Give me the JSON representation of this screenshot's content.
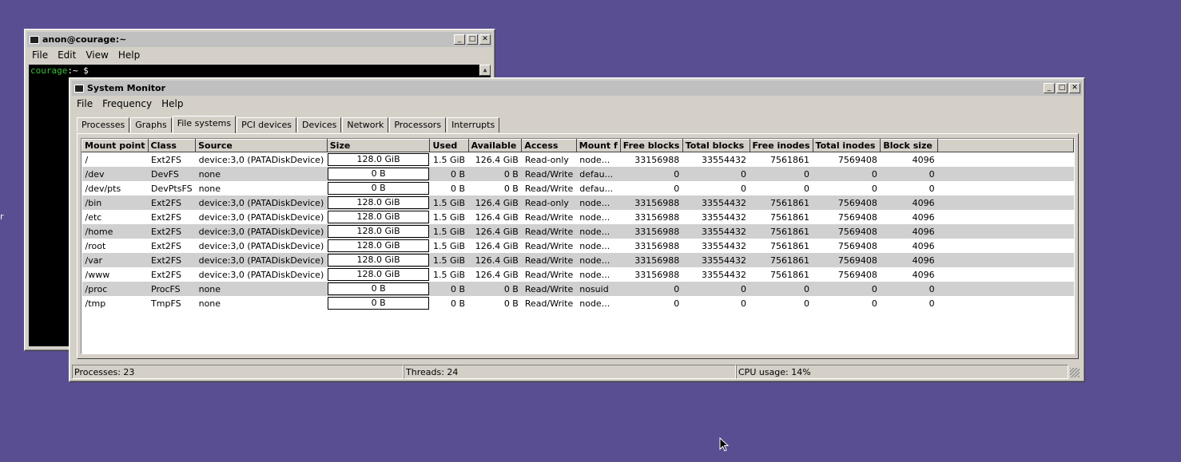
{
  "desktop": {
    "edge_glyph": "r"
  },
  "terminal": {
    "title": "anon@courage:~",
    "menu": [
      "File",
      "Edit",
      "View",
      "Help"
    ],
    "prompt_host": "courage",
    "prompt_rest": ":~ $"
  },
  "sysmon": {
    "title": "System Monitor",
    "menu": [
      "File",
      "Frequency",
      "Help"
    ],
    "tabs": [
      "Processes",
      "Graphs",
      "File systems",
      "PCI devices",
      "Devices",
      "Network",
      "Processors",
      "Interrupts"
    ],
    "active_tab": "File systems",
    "columns": [
      "Mount point",
      "Class",
      "Source",
      "Size",
      "Used",
      "Available",
      "Access",
      "Mount f",
      "Free blocks",
      "Total blocks",
      "Free inodes",
      "Total inodes",
      "Block size"
    ],
    "rows": [
      [
        "/",
        "Ext2FS",
        "device:3,0 (PATADiskDevice)",
        "128.0 GiB",
        "1.5 GiB",
        "126.4 GiB",
        "Read-only",
        "node...",
        "33156988",
        "33554432",
        "7561861",
        "7569408",
        "4096"
      ],
      [
        "/dev",
        "DevFS",
        "none",
        "0 B",
        "0 B",
        "0 B",
        "Read/Write",
        "defau...",
        "0",
        "0",
        "0",
        "0",
        "0"
      ],
      [
        "/dev/pts",
        "DevPtsFS",
        "none",
        "0 B",
        "0 B",
        "0 B",
        "Read/Write",
        "defau...",
        "0",
        "0",
        "0",
        "0",
        "0"
      ],
      [
        "/bin",
        "Ext2FS",
        "device:3,0 (PATADiskDevice)",
        "128.0 GiB",
        "1.5 GiB",
        "126.4 GiB",
        "Read-only",
        "node...",
        "33156988",
        "33554432",
        "7561861",
        "7569408",
        "4096"
      ],
      [
        "/etc",
        "Ext2FS",
        "device:3,0 (PATADiskDevice)",
        "128.0 GiB",
        "1.5 GiB",
        "126.4 GiB",
        "Read/Write",
        "node...",
        "33156988",
        "33554432",
        "7561861",
        "7569408",
        "4096"
      ],
      [
        "/home",
        "Ext2FS",
        "device:3,0 (PATADiskDevice)",
        "128.0 GiB",
        "1.5 GiB",
        "126.4 GiB",
        "Read/Write",
        "node...",
        "33156988",
        "33554432",
        "7561861",
        "7569408",
        "4096"
      ],
      [
        "/root",
        "Ext2FS",
        "device:3,0 (PATADiskDevice)",
        "128.0 GiB",
        "1.5 GiB",
        "126.4 GiB",
        "Read/Write",
        "node...",
        "33156988",
        "33554432",
        "7561861",
        "7569408",
        "4096"
      ],
      [
        "/var",
        "Ext2FS",
        "device:3,0 (PATADiskDevice)",
        "128.0 GiB",
        "1.5 GiB",
        "126.4 GiB",
        "Read/Write",
        "node...",
        "33156988",
        "33554432",
        "7561861",
        "7569408",
        "4096"
      ],
      [
        "/www",
        "Ext2FS",
        "device:3,0 (PATADiskDevice)",
        "128.0 GiB",
        "1.5 GiB",
        "126.4 GiB",
        "Read/Write",
        "node...",
        "33156988",
        "33554432",
        "7561861",
        "7569408",
        "4096"
      ],
      [
        "/proc",
        "ProcFS",
        "none",
        "0 B",
        "0 B",
        "0 B",
        "Read/Write",
        "nosuid",
        "0",
        "0",
        "0",
        "0",
        "0"
      ],
      [
        "/tmp",
        "TmpFS",
        "none",
        "0 B",
        "0 B",
        "0 B",
        "Read/Write",
        "node...",
        "0",
        "0",
        "0",
        "0",
        "0"
      ]
    ],
    "status": {
      "processes": "Processes: 23",
      "threads": "Threads: 24",
      "cpu": "CPU usage: 14%"
    }
  },
  "colors": {
    "desktop": "#5a4e93",
    "prompt_host": "#39c03a",
    "row_alt": "#d0d0d0"
  }
}
